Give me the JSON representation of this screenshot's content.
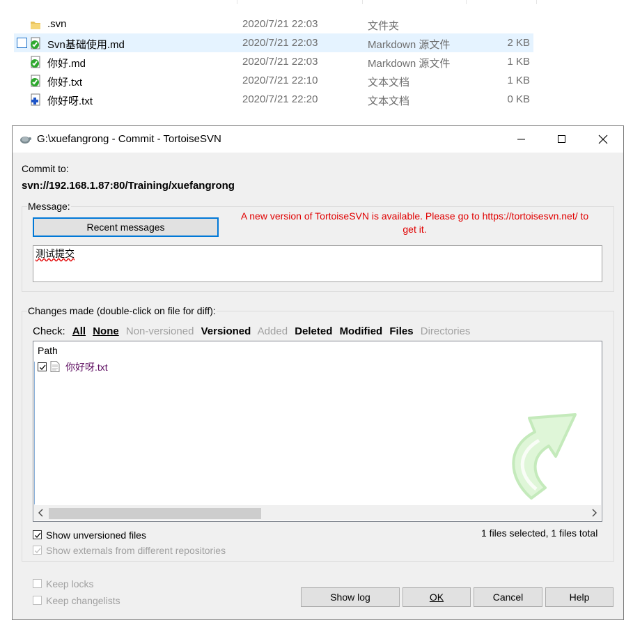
{
  "explorer": {
    "rows": [
      {
        "name": ".svn",
        "date": "2020/7/21 22:03",
        "type": "文件夹",
        "size": "",
        "icon": "folder-icon"
      },
      {
        "name": "Svn基础使用.md",
        "date": "2020/7/21 22:03",
        "type": "Markdown 源文件",
        "size": "2 KB",
        "icon": "svn-normal-overlay-icon",
        "selected": true
      },
      {
        "name": "你好.md",
        "date": "2020/7/21 22:03",
        "type": "Markdown 源文件",
        "size": "1 KB",
        "icon": "svn-normal-overlay-icon"
      },
      {
        "name": "你好.txt",
        "date": "2020/7/21 22:10",
        "type": "文本文档",
        "size": "1 KB",
        "icon": "svn-normal-overlay-icon"
      },
      {
        "name": "你好呀.txt",
        "date": "2020/7/21 22:20",
        "type": "文本文档",
        "size": "0 KB",
        "icon": "svn-added-overlay-icon"
      }
    ]
  },
  "dialog": {
    "title": "G:\\xuefangrong - Commit - TortoiseSVN",
    "commit_to_label": "Commit to:",
    "commit_url": "svn://192.168.1.87:80/Training/xuefangrong",
    "message_label": "Message:",
    "recent_messages_label": "Recent messages",
    "notice_line1": "A new version of TortoiseSVN is available. Please go to https://tortoisesvn.net/ to",
    "notice_line2": "get it.",
    "message_text": "测试提交",
    "changes_label": "Changes made (double-click on file for diff):",
    "check_label": "Check:",
    "filters": [
      "All",
      "None",
      "Non-versioned",
      "Versioned",
      "Added",
      "Deleted",
      "Modified",
      "Files",
      "Directories"
    ],
    "path_header": "Path",
    "files": [
      {
        "name": "你好呀.txt",
        "checked": true
      }
    ],
    "show_unversioned": "Show unversioned files",
    "show_externals": "Show externals from different repositories",
    "selection_status": "1 files selected, 1 files total",
    "keep_locks": "Keep locks",
    "keep_changelists": "Keep changelists",
    "buttons": {
      "show_log": "Show log",
      "ok": "OK",
      "cancel": "Cancel",
      "help": "Help"
    },
    "accent_color": "#0078d7",
    "notice_color": "#e00000"
  }
}
